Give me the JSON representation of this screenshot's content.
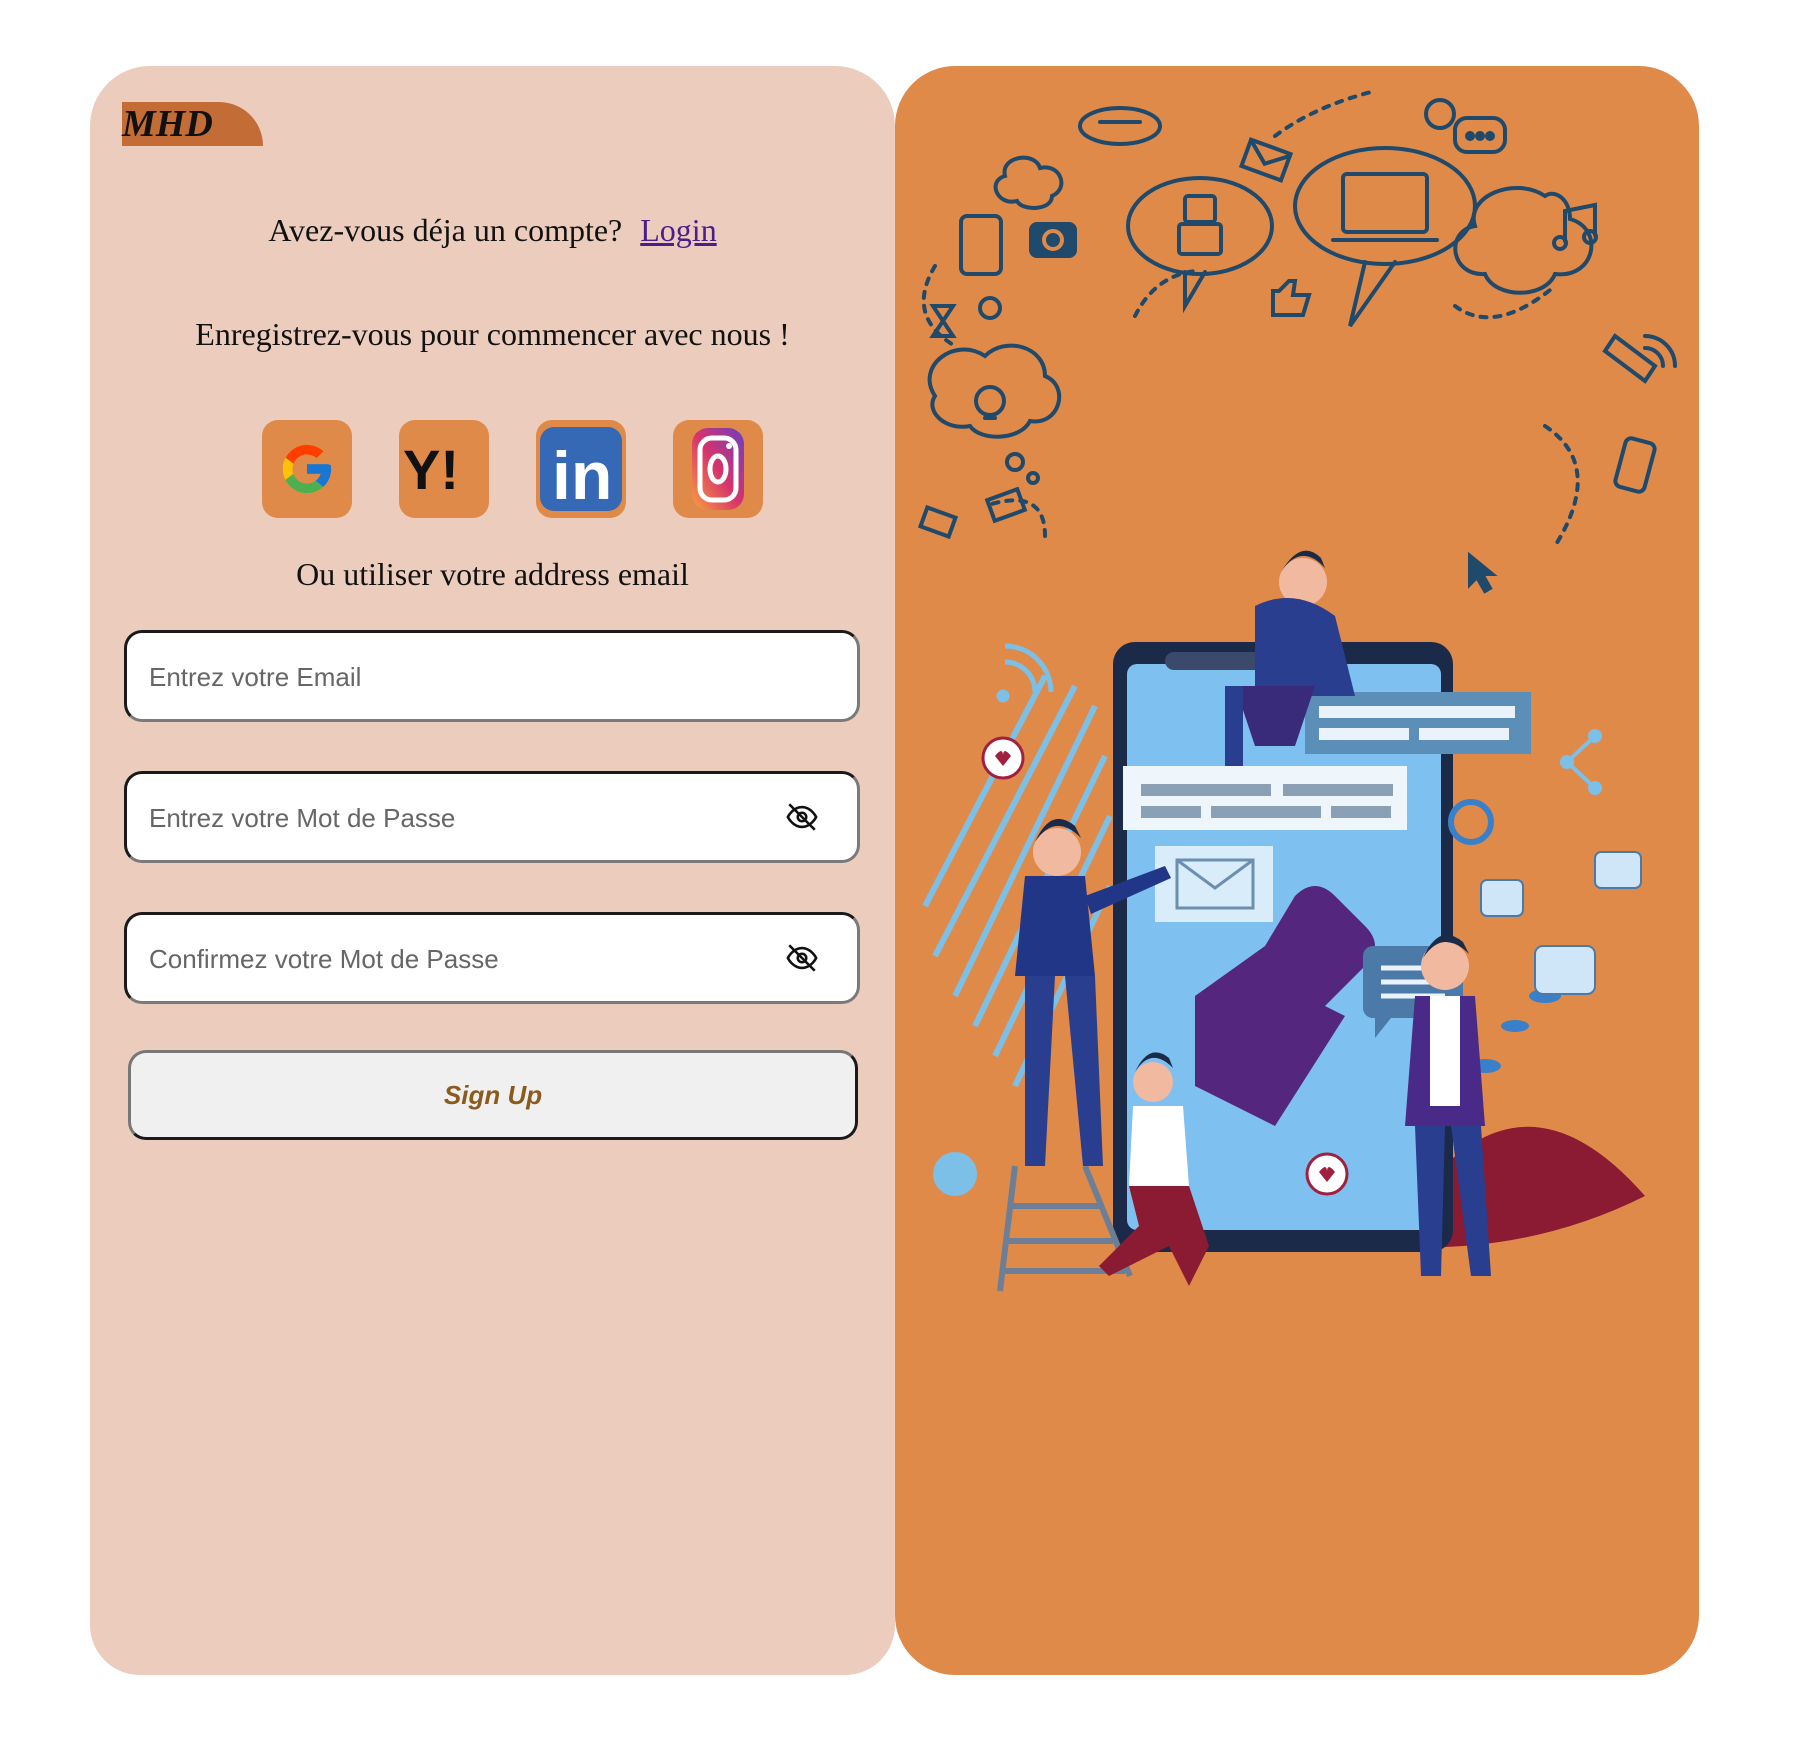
{
  "brand": {
    "logo_text": "MHD"
  },
  "account": {
    "prompt": "Avez-vous déja un compte?",
    "login_link": "Login"
  },
  "tagline": "Enregistrez-vous pour commencer avec nous !",
  "socials": [
    {
      "name": "google",
      "icon": "google-icon"
    },
    {
      "name": "yahoo",
      "icon": "yahoo-icon",
      "text": "Y!"
    },
    {
      "name": "linkedin",
      "icon": "linkedin-icon",
      "text": "in"
    },
    {
      "name": "instagram",
      "icon": "instagram-icon"
    }
  ],
  "or_email_text": "Ou utiliser votre address email",
  "form": {
    "email_placeholder": "Entrez votre Email",
    "password_placeholder": "Entrez votre Mot de Passe",
    "confirm_placeholder": "Confirmez votre Mot de Passe",
    "submit_label": "Sign Up"
  },
  "colors": {
    "left_panel": "#ebccbd",
    "right_panel": "#e08a4a",
    "logo_bg": "#c46c36",
    "link": "#4b1e8c",
    "submit_text": "#8b5a1e"
  }
}
